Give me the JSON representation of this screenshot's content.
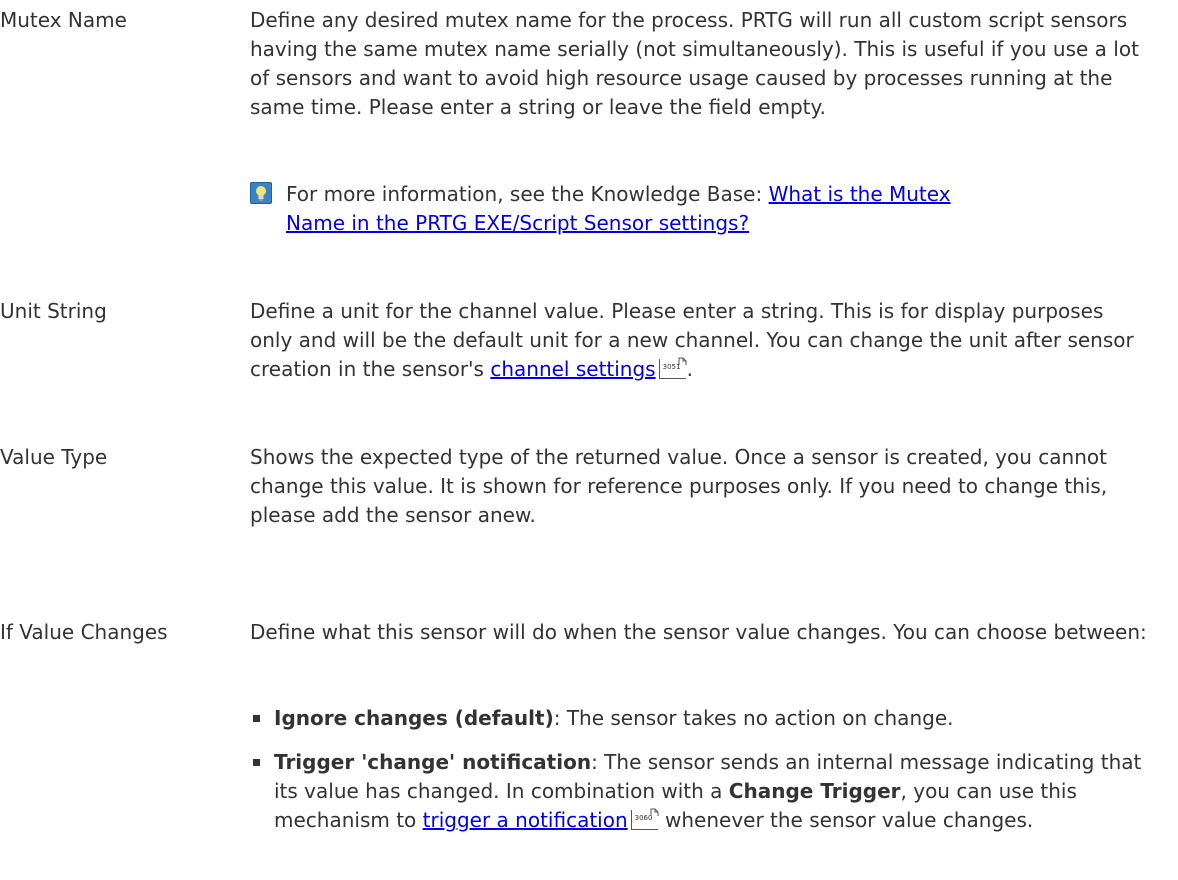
{
  "rows": {
    "mutex": {
      "label": "Mutex Name",
      "text": "Define any desired mutex name for the process. PRTG will run all custom script sensors having the same mutex name serially (not simultaneously). This is useful if you use a lot of sensors and want to avoid high resource usage caused by processes running at the same time. Please enter a string or leave the field empty.",
      "note_prefix": "For more information, see the Knowledge Base: ",
      "note_link": "What is the Mutex Name in the PRTG EXE/Script Sensor settings?"
    },
    "unit": {
      "label": "Unit String",
      "text": "Define a unit for the channel value. Please enter a string. This is for display purposes only and will be the default unit for a new channel.  You can change the unit after sensor creation in the sensor's ",
      "link": "channel settings",
      "page_ref": "3051",
      "suffix": "."
    },
    "value_type": {
      "label": "Value Type",
      "text": "Shows the expected type of the returned value. Once a sensor is created, you cannot change this value. It is shown for reference purposes only. If you need to change this, please add the sensor anew."
    },
    "value_changes": {
      "label": "If Value Changes",
      "text": "Define what this sensor will do when the sensor value changes. You can choose between:",
      "options": [
        {
          "name": "Ignore changes (default)",
          "desc": ": The sensor takes no action on change."
        },
        {
          "name": "Trigger 'change' notification",
          "desc_before": ": The sensor sends an internal message indicating that its value has changed. In combination with a ",
          "bold": "Change Trigger",
          "desc_mid": ", you can use this mechanism to ",
          "link": "trigger a notification",
          "page_ref": "3060",
          "desc_after": " whenever the sensor value changes."
        }
      ]
    }
  },
  "colors": {
    "text": "#333333",
    "link": "#0000ee"
  }
}
